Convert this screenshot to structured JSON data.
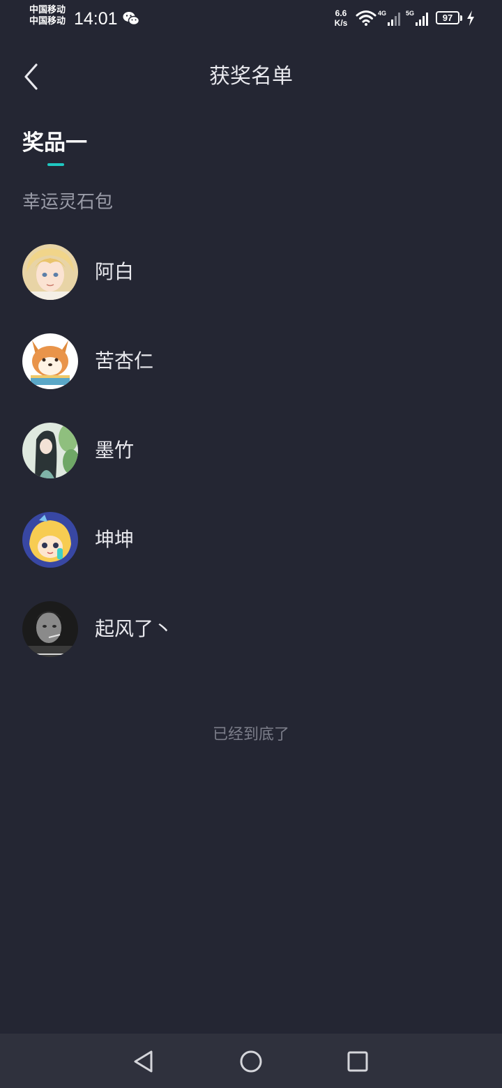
{
  "status_bar": {
    "carrier_1": "中国移动",
    "carrier_2": "中国移动",
    "time": "14:01",
    "net_speed_value": "6.6",
    "net_speed_unit": "K/s",
    "signal_1": "4G",
    "signal_2": "5G",
    "battery": "97"
  },
  "header": {
    "title": "获奖名单"
  },
  "tab": {
    "label": "奖品一"
  },
  "prize": {
    "name": "幸运灵石包"
  },
  "winners": [
    {
      "name": "阿白"
    },
    {
      "name": "苦杏仁"
    },
    {
      "name": "墨竹"
    },
    {
      "name": "坤坤"
    },
    {
      "name": "起风了丶"
    }
  ],
  "list_end_text": "已经到底了",
  "colors": {
    "background": "#242633",
    "accent": "#1fc7c1",
    "nav_bar": "#2f313d"
  }
}
